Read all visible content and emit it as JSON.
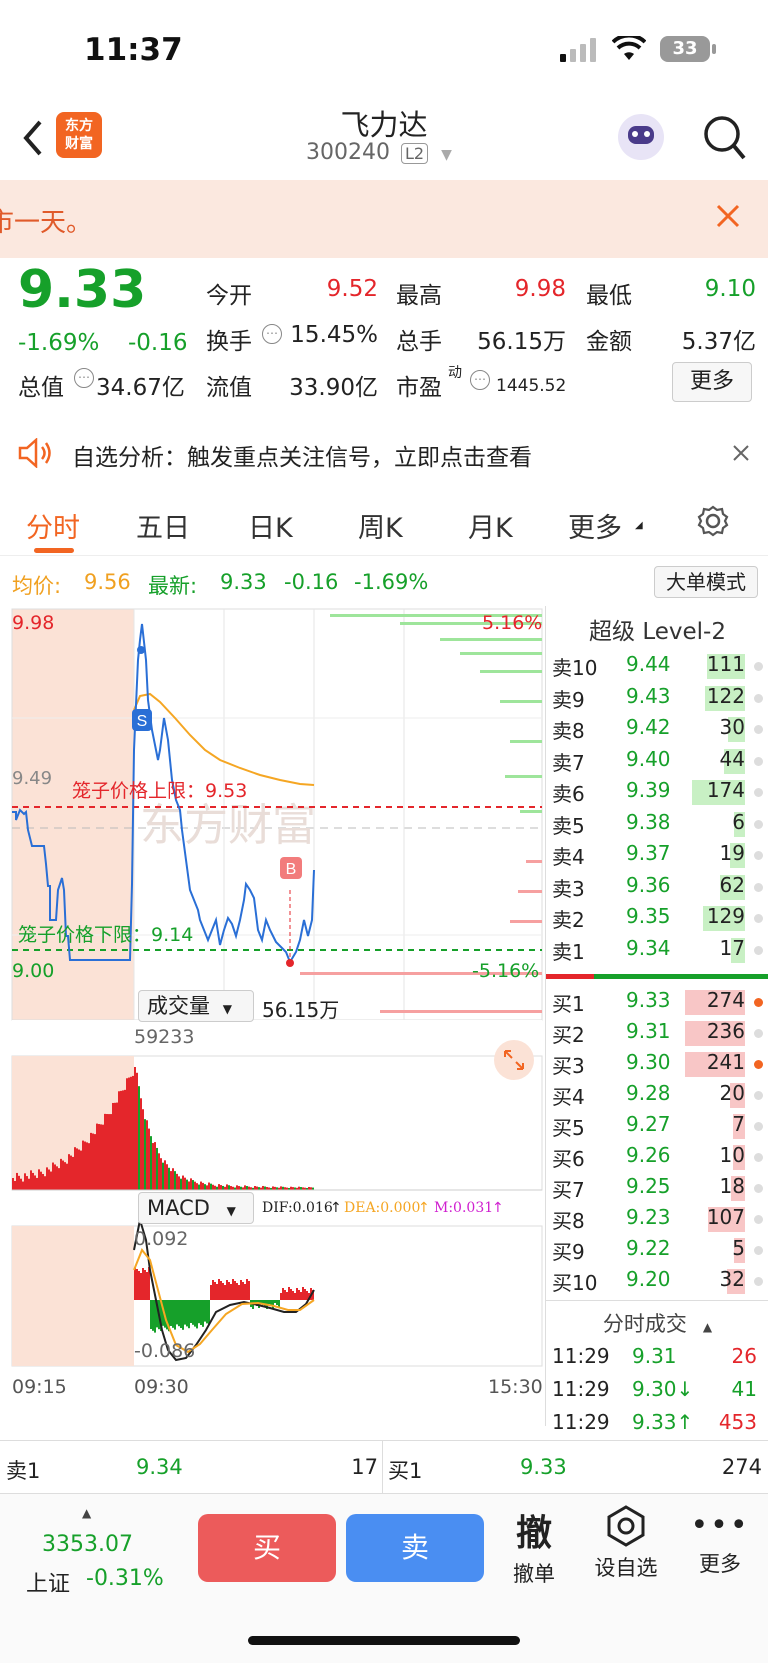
{
  "status_bar": {
    "time": "11:37",
    "battery": "33"
  },
  "header": {
    "logo_text": "东方\n财富",
    "stock_name": "飞力达",
    "stock_code": "300240",
    "badge": "L2"
  },
  "banner": {
    "text": "市一天。"
  },
  "quote": {
    "price": "9.33",
    "change_pct": "-1.69%",
    "change": "-0.16",
    "fields": [
      {
        "label": "今开",
        "value": "9.52"
      },
      {
        "label": "最高",
        "value": "9.98"
      },
      {
        "label": "最低",
        "value": "9.10"
      },
      {
        "label": "换手",
        "value": "15.45%"
      },
      {
        "label": "总手",
        "value": "56.15万"
      },
      {
        "label": "金额",
        "value": "5.37亿"
      },
      {
        "label": "总值",
        "value": "34.67亿"
      },
      {
        "label": "流值",
        "value": "33.90亿"
      },
      {
        "label": "市盈",
        "sup": "动",
        "value": "1445.52"
      }
    ],
    "more_button": "更多"
  },
  "notice": {
    "text": "自选分析：触发重点关注信号，立即点击查看"
  },
  "tabs": [
    "分时",
    "五日",
    "日K",
    "周K",
    "月K",
    "更多"
  ],
  "info_line": {
    "avg_label": "均价:",
    "avg": "9.56",
    "latest_label": "最新:",
    "latest": "9.33",
    "change": "-0.16",
    "pct": "-1.69%",
    "mode_button": "大单模式"
  },
  "chart": {
    "y_top": "9.98",
    "y_bottom": "9.00",
    "y_mid": "9.49",
    "pct_top": "5.16%",
    "pct_bottom": "-5.16%",
    "cage_upper": "笼子价格上限：9.53",
    "cage_lower": "笼子价格下限：9.14",
    "marker_s": "S",
    "marker_b": "B",
    "watermark": "东方财富",
    "volume_label": "成交量",
    "volume_total": "56.15万",
    "volume_max": "59233",
    "macd_label": "MACD",
    "dif": "DIF:0.016",
    "dea": "DEA:0.000",
    "m": "M:0.031",
    "macd_top": "0.092",
    "macd_bottom": "-0.086",
    "time_start": "09:15",
    "time_open": "09:30",
    "time_end": "15:30"
  },
  "order_book": {
    "title": "超级 Level-2",
    "asks": [
      {
        "name": "卖10",
        "price": "9.44",
        "vol": "111"
      },
      {
        "name": "卖9",
        "price": "9.43",
        "vol": "122"
      },
      {
        "name": "卖8",
        "price": "9.42",
        "vol": "30"
      },
      {
        "name": "卖7",
        "price": "9.40",
        "vol": "44"
      },
      {
        "name": "卖6",
        "price": "9.39",
        "vol": "174"
      },
      {
        "name": "卖5",
        "price": "9.38",
        "vol": "6"
      },
      {
        "name": "卖4",
        "price": "9.37",
        "vol": "19"
      },
      {
        "name": "卖3",
        "price": "9.36",
        "vol": "62"
      },
      {
        "name": "卖2",
        "price": "9.35",
        "vol": "129"
      },
      {
        "name": "卖1",
        "price": "9.34",
        "vol": "17"
      }
    ],
    "bids": [
      {
        "name": "买1",
        "price": "9.33",
        "vol": "274"
      },
      {
        "name": "买2",
        "price": "9.31",
        "vol": "236"
      },
      {
        "name": "买3",
        "price": "9.30",
        "vol": "241"
      },
      {
        "name": "买4",
        "price": "9.28",
        "vol": "20"
      },
      {
        "name": "买5",
        "price": "9.27",
        "vol": "7"
      },
      {
        "name": "买6",
        "price": "9.26",
        "vol": "10"
      },
      {
        "name": "买7",
        "price": "9.25",
        "vol": "18"
      },
      {
        "name": "买8",
        "price": "9.23",
        "vol": "107"
      },
      {
        "name": "买9",
        "price": "9.22",
        "vol": "5"
      },
      {
        "name": "买10",
        "price": "9.20",
        "vol": "32"
      }
    ],
    "trades_title": "分时成交",
    "trades": [
      {
        "time": "11:29",
        "price": "9.31",
        "vol": "26"
      },
      {
        "time": "11:29",
        "price": "9.30↓",
        "vol": "41"
      },
      {
        "time": "11:29",
        "price": "9.33↑",
        "vol": "453"
      }
    ]
  },
  "bottom_row": {
    "sell_label": "卖1",
    "sell_price": "9.34",
    "sell_vol": "17",
    "buy_label": "买1",
    "buy_price": "9.33",
    "buy_vol": "274"
  },
  "toolbar": {
    "index_value": "3353.07",
    "index_name": "上证",
    "index_pct": "-0.31%",
    "buy": "买",
    "sell": "卖",
    "cancel_icon": "撤",
    "cancel": "撤单",
    "watch": "设自选",
    "more": "更多"
  }
}
